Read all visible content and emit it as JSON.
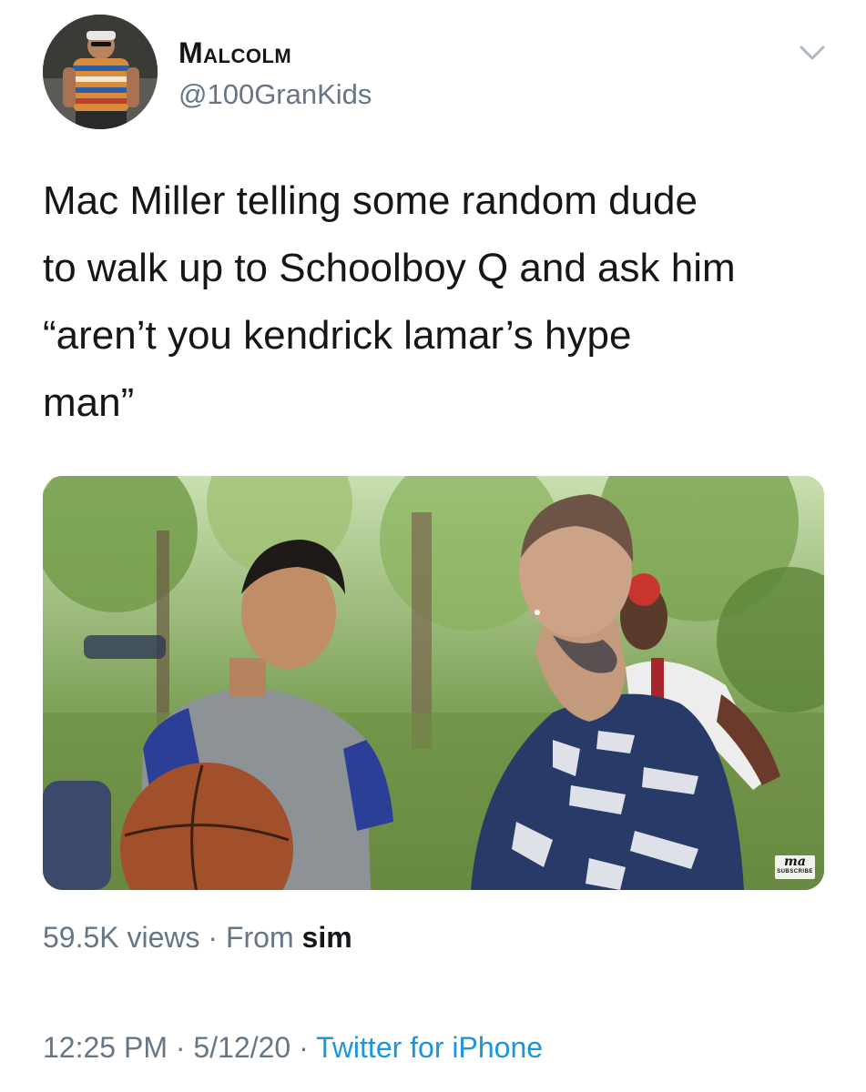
{
  "author": {
    "display_name": "Malcolm",
    "handle": "@100GranKids"
  },
  "tweet": {
    "text": "Mac Miller telling some random dude\nto walk up to Schoolboy Q and ask him\n“aren’t you kendrick lamar’s hype\nman”"
  },
  "media": {
    "watermark_logo": "ma",
    "watermark_sub": "SUBSCRIBE"
  },
  "stats": {
    "views": "59.5K views",
    "separator": " · ",
    "from_label": "From ",
    "source": "sim"
  },
  "meta": {
    "time": "12:25 PM",
    "separator": " · ",
    "date": "5/12/20",
    "client": "Twitter for iPhone"
  },
  "icons": {
    "caret": "chevron-down-icon"
  },
  "colors": {
    "text_primary": "#14171a",
    "text_secondary": "#657786",
    "link": "#1b95e0",
    "background": "#ffffff"
  }
}
